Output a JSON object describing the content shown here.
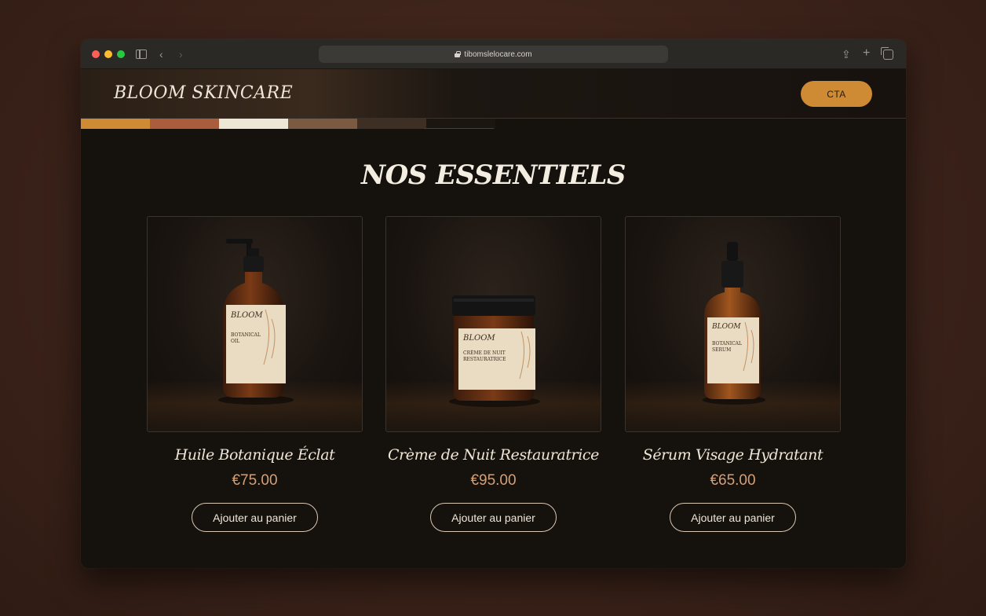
{
  "browser": {
    "url": "tibomslelocare.com",
    "icons": [
      "sidebar-icon",
      "back-icon",
      "forward-icon",
      "lock-icon",
      "share-icon",
      "new-tab-icon",
      "tabs-overview-icon"
    ],
    "back_glyph": "‹",
    "forward_glyph": "›",
    "share_glyph": "⇪",
    "plus_glyph": "+"
  },
  "header": {
    "logo": "BLOOM SKINCARE",
    "cta_label": "CTA"
  },
  "palette": [
    "#cf8b34",
    "#a95d3c",
    "#efe7d6",
    "#7a5a40",
    "#3d2f24",
    "#1c1611"
  ],
  "section": {
    "title": "NOS ESSENTIELS"
  },
  "products": [
    {
      "name": "Huile Botanique Éclat",
      "price": "€75.00",
      "button": "Ajouter au panier",
      "label_brand": "BLOOM",
      "label_line1": "BOTANICAL",
      "label_line2": "OIL"
    },
    {
      "name": "Crème de Nuit Restauratrice",
      "price": "€95.00",
      "button": "Ajouter au panier",
      "label_brand": "BLOOM",
      "label_line1": "CRÈME DE NUIT",
      "label_line2": "RESTAURATRICE"
    },
    {
      "name": "Sérum Visage Hydratant",
      "price": "€65.00",
      "button": "Ajouter au panier",
      "label_brand": "BLOOM",
      "label_line1": "BOTANICAL",
      "label_line2": "SERUM"
    }
  ],
  "colors": {
    "accent": "#cf8b34",
    "price": "#d3a079",
    "background": "#15110d"
  }
}
